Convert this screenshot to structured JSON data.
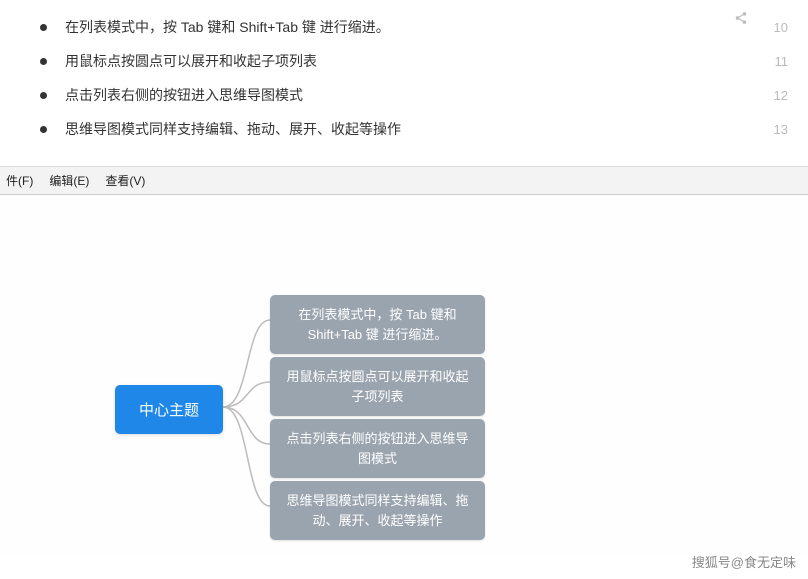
{
  "list": {
    "items": [
      {
        "text": "在列表模式中，按 Tab 键和 Shift+Tab 键 进行缩进。",
        "num": "10"
      },
      {
        "text": "用鼠标点按圆点可以展开和收起子项列表",
        "num": "11"
      },
      {
        "text": "点击列表右侧的按钮进入思维导图模式",
        "num": "12"
      },
      {
        "text": "思维导图模式同样支持编辑、拖动、展开、收起等操作",
        "num": "13"
      }
    ]
  },
  "menu": {
    "file": "件(F)",
    "edit": "编辑(E)",
    "view": "查看(V)"
  },
  "mindmap": {
    "central": "中心主题",
    "children": [
      "在列表模式中，按 Tab 键和 Shift+Tab 键 进行缩进。",
      "用鼠标点按圆点可以展开和收起子项列表",
      "点击列表右侧的按钮进入思维导图模式",
      "思维导图模式同样支持编辑、拖动、展开、收起等操作"
    ]
  },
  "watermark": "搜狐号@食无定味"
}
